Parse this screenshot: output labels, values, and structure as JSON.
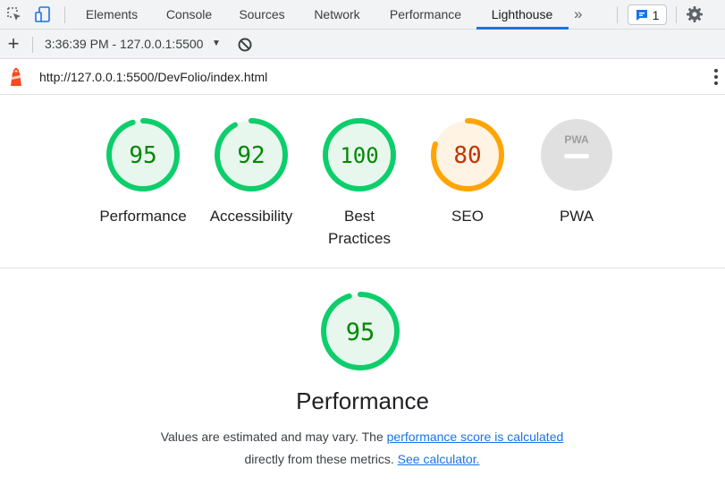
{
  "devtools": {
    "tabs": [
      {
        "label": "Elements"
      },
      {
        "label": "Console"
      },
      {
        "label": "Sources"
      },
      {
        "label": "Network"
      },
      {
        "label": "Performance"
      },
      {
        "label": "Lighthouse",
        "active": true
      }
    ],
    "more_tabs_icon": "double-chevron-right-icon",
    "issues_count": "1",
    "settings_icon": "gear-icon",
    "accent_color": "#1a73e8"
  },
  "toolbar": {
    "add_label": "+",
    "report_label": "3:36:39 PM - 127.0.0.1:5500",
    "report_caret": "▼",
    "clear_icon": "block-icon"
  },
  "report": {
    "url": "http://127.0.0.1:5500/DevFolio/index.html",
    "categories": [
      {
        "id": "performance",
        "score": 95,
        "score_text": "95",
        "label_lines": [
          "Performance"
        ],
        "status": "pass"
      },
      {
        "id": "accessibility",
        "score": 92,
        "score_text": "92",
        "label_lines": [
          "Accessibility"
        ],
        "status": "pass"
      },
      {
        "id": "best-practices",
        "score": 100,
        "score_text": "100",
        "label_lines": [
          "Best",
          "Practices"
        ],
        "status": "pass"
      },
      {
        "id": "seo",
        "score": 80,
        "score_text": "80",
        "label_lines": [
          "SEO"
        ],
        "status": "average"
      },
      {
        "id": "pwa",
        "score": null,
        "score_text": "",
        "badge_text": "PWA",
        "label_lines": [
          "PWA"
        ],
        "status": "na"
      }
    ],
    "performance_section": {
      "score": 95,
      "score_text": "95",
      "title": "Performance",
      "desc_prefix": "Values are estimated and may vary. The ",
      "desc_link": "performance score is calculated",
      "desc_middle": " directly from these metrics. ",
      "desc_link2": "See calculator."
    }
  },
  "colors": {
    "pass_stroke": "#0cce6b",
    "pass_fill": "#e7f7ee",
    "pass_text": "#008800",
    "average_stroke": "#ffa400",
    "average_fill": "#fff3e3",
    "average_text": "#c33300",
    "na_fill": "#e0e0e0",
    "na_text": "#9e9e9e"
  }
}
